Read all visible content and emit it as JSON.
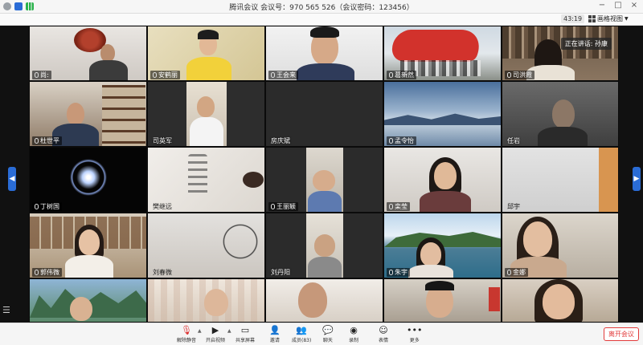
{
  "window": {
    "title": "腾讯会议 会议号：970 565 526（会议密码：123456）",
    "minimize": "−",
    "maximize": "□",
    "close": "×"
  },
  "status": {
    "timer": "43:19",
    "view_label": "画格视图",
    "speaking_label": "正在讲话: 孙康"
  },
  "participants": [
    {
      "name": "尚:",
      "mic": true
    },
    {
      "name": "安鹤丽",
      "mic": true
    },
    {
      "name": "王会来",
      "mic": true
    },
    {
      "name": "葛新然",
      "mic": true
    },
    {
      "name": "司洪霞",
      "mic": true
    },
    {
      "name": "杜世平",
      "mic": true
    },
    {
      "name": "司英军",
      "mic": false
    },
    {
      "name": "房庆斌",
      "mic": false
    },
    {
      "name": "孟令怡",
      "mic": true
    },
    {
      "name": "任岩",
      "mic": false
    },
    {
      "name": "丁树国",
      "mic": true
    },
    {
      "name": "樊继远",
      "mic": false
    },
    {
      "name": "王丽颖",
      "mic": true
    },
    {
      "name": "栾莹",
      "mic": true
    },
    {
      "name": "邱宇",
      "mic": false
    },
    {
      "name": "郭伟微",
      "mic": true
    },
    {
      "name": "刘春微",
      "mic": false
    },
    {
      "name": "刘丹阳",
      "mic": false
    },
    {
      "name": "朱宇",
      "mic": true
    },
    {
      "name": "金娜",
      "mic": true
    },
    {
      "name": "",
      "mic": false
    },
    {
      "name": "",
      "mic": false
    },
    {
      "name": "",
      "mic": false
    },
    {
      "name": "",
      "mic": false
    },
    {
      "name": "",
      "mic": false
    }
  ],
  "toolbar": {
    "unmute": "解除静音",
    "start_video": "开启视频",
    "share_screen": "共享屏幕",
    "invite": "邀请",
    "members": "成员(83)",
    "chat": "聊天",
    "record": "录制",
    "reactions": "表情",
    "more": "更多",
    "leave": "离开会议"
  },
  "colors": {
    "accent": "#2a6cd6",
    "leave": "#e23b3b"
  }
}
